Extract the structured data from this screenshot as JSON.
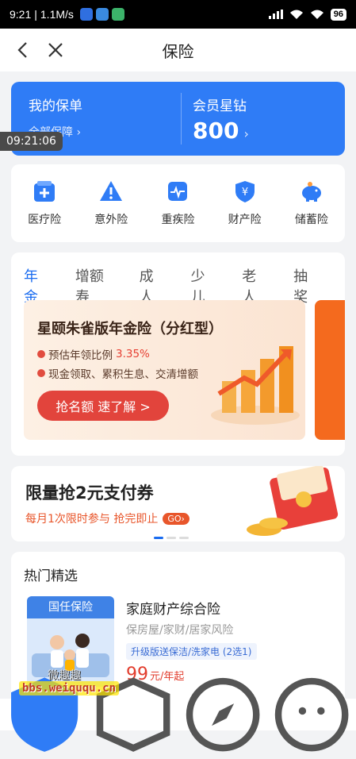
{
  "status": {
    "time": "9:21",
    "speed": "1.1M/s",
    "battery": "96"
  },
  "nav": {
    "title": "保险"
  },
  "banner": {
    "policy_title": "我的保单",
    "policy_sub": "全部保障 ›",
    "member_title": "会员星钻",
    "member_value": "800",
    "member_arrow": "›"
  },
  "overlay_time": "09:21:06",
  "categories": [
    {
      "label": "医疗险",
      "icon": "medical-icon"
    },
    {
      "label": "意外险",
      "icon": "warning-icon"
    },
    {
      "label": "重疾险",
      "icon": "heartbeat-icon"
    },
    {
      "label": "财产险",
      "icon": "shield-yen-icon"
    },
    {
      "label": "储蓄险",
      "icon": "piggy-bank-icon"
    }
  ],
  "tabs": [
    "年金",
    "增额寿",
    "成人",
    "少儿",
    "老人",
    "抽奖"
  ],
  "product_card": {
    "title": "星颐朱雀版年金险（分红型）",
    "line1_prefix": "预估年领比例",
    "line1_value": "3.35%",
    "line2": "现金领取、累积生息、交清增额",
    "button": "抢名额 速了解 >"
  },
  "coupon": {
    "title": "限量抢2元支付券",
    "sub": "每月1次限时参与 抢完即止",
    "go": "GO›"
  },
  "hot": {
    "title": "热门精选",
    "brand": "国任保险",
    "name": "家庭财产综合险",
    "desc": "保房屋/家财/居家风险",
    "tag": "升级版送保洁/洗家电 (2选1)",
    "price": "99",
    "price_unit": "元/年起"
  },
  "watermark": {
    "text": "bbs.weiququ.cn",
    "logo": "微趣趣"
  },
  "colors": {
    "brand_blue": "#2f7cf6",
    "accent_red": "#e2443c",
    "orange": "#e8562b"
  }
}
